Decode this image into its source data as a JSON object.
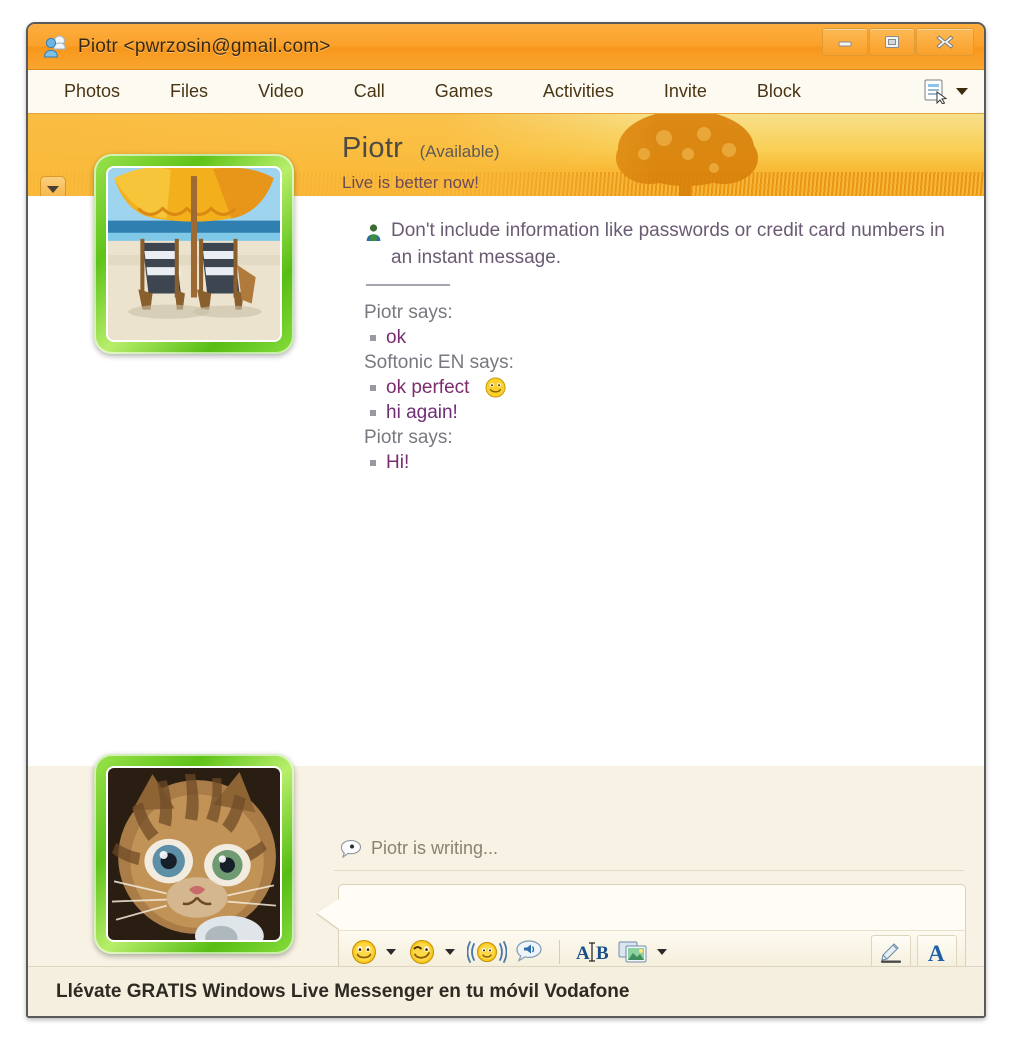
{
  "window": {
    "title": "Piotr <pwrzosin@gmail.com>",
    "title_icon": "contact-people-icon",
    "controls": [
      {
        "name": "minimize",
        "icon": "minimize-icon"
      },
      {
        "name": "maximize",
        "icon": "maximize-icon"
      },
      {
        "name": "close",
        "icon": "close-icon"
      }
    ]
  },
  "menubar": {
    "items": [
      {
        "label": "Photos"
      },
      {
        "label": "Files"
      },
      {
        "label": "Video"
      },
      {
        "label": "Call"
      },
      {
        "label": "Games"
      },
      {
        "label": "Activities"
      },
      {
        "label": "Invite"
      },
      {
        "label": "Block"
      }
    ],
    "right_tool_icon": "show-menu-icon",
    "right_tool_caret": "chevron-down-icon"
  },
  "header": {
    "contact_name": "Piotr",
    "contact_status": "(Available)",
    "personal_message": "Live is better now!",
    "scene_description": "tree-in-grass-scene"
  },
  "rail": {
    "top_button_icon": "chevron-down-icon",
    "webcam_icon": "webcam-icon",
    "bottom_button_icon": "chevron-down-icon"
  },
  "display_pictures": {
    "contact": "beach-umbrella-chairs-photo",
    "self": "kitten-photo",
    "frame_color": "#6ecb20"
  },
  "chat": {
    "warning_icon": "security-shield-person-icon",
    "warning_text": "Don't include information like passwords or credit card numbers in an instant message.",
    "messages": [
      {
        "speaker": "Piotr says:",
        "lines": [
          {
            "text": "ok",
            "emoticon": null
          }
        ]
      },
      {
        "speaker": "Softonic EN says:",
        "lines": [
          {
            "text": "ok perfect",
            "emoticon": "smiley-face-icon"
          },
          {
            "text": "hi again!",
            "emoticon": null
          }
        ]
      },
      {
        "speaker": "Piotr says:",
        "lines": [
          {
            "text": "Hi!",
            "emoticon": null
          }
        ]
      }
    ]
  },
  "compose": {
    "writing_icon": "speech-bubble-icon",
    "writing_text": "Piotr is writing...",
    "input_value": "",
    "input_placeholder": "",
    "toolbar": [
      {
        "name": "emoticon-button",
        "icon": "smiley-face-icon",
        "has_caret": true
      },
      {
        "name": "wink-button",
        "icon": "winking-face-icon",
        "has_caret": true
      },
      {
        "name": "nudge-button",
        "icon": "nudge-shaking-face-icon",
        "has_caret": false
      },
      {
        "name": "voice-clip-button",
        "icon": "voice-clip-speaker-icon",
        "has_caret": false
      },
      {
        "name": "text-select-button",
        "icon": "ab-text-cursor-icon",
        "has_caret": false
      },
      {
        "name": "background-button",
        "icon": "photo-background-icon",
        "has_caret": true
      }
    ],
    "right_tools": [
      {
        "name": "handwriting-button",
        "icon": "pen-handwriting-icon"
      },
      {
        "name": "font-button",
        "icon": "font-letter-a-icon"
      }
    ]
  },
  "ad": {
    "text": "Llévate GRATIS Windows Live Messenger en tu móvil Vodafone"
  }
}
